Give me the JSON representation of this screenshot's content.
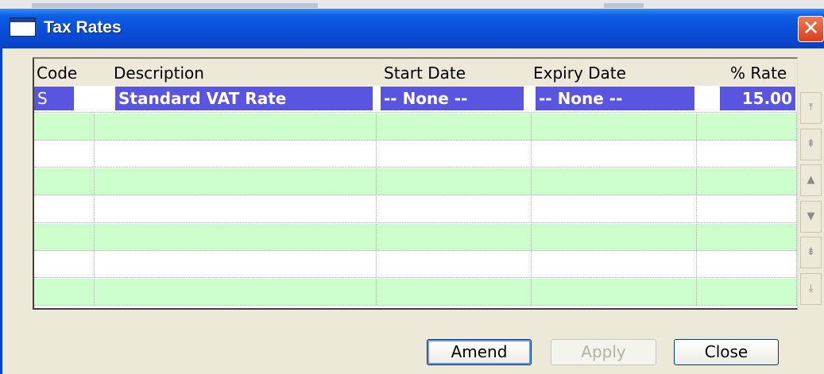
{
  "window": {
    "title": "Tax Rates",
    "close_glyph": "✕",
    "titlebar_color": "#0a50d8",
    "body_color": "#ece9d8"
  },
  "grid": {
    "columns": [
      "Code",
      "Description",
      "Start Date",
      "Expiry Date",
      "% Rate"
    ],
    "rows": [
      {
        "code": "S",
        "description": "Standard VAT Rate",
        "start_date": "-- None --",
        "expiry_date": "-- None --",
        "rate": "15.00",
        "selected": true
      },
      {
        "code": "",
        "description": "",
        "start_date": "",
        "expiry_date": "",
        "rate": ""
      },
      {
        "code": "",
        "description": "",
        "start_date": "",
        "expiry_date": "",
        "rate": ""
      },
      {
        "code": "",
        "description": "",
        "start_date": "",
        "expiry_date": "",
        "rate": ""
      },
      {
        "code": "",
        "description": "",
        "start_date": "",
        "expiry_date": "",
        "rate": ""
      },
      {
        "code": "",
        "description": "",
        "start_date": "",
        "expiry_date": "",
        "rate": ""
      },
      {
        "code": "",
        "description": "",
        "start_date": "",
        "expiry_date": "",
        "rate": ""
      },
      {
        "code": "",
        "description": "",
        "start_date": "",
        "expiry_date": "",
        "rate": ""
      }
    ],
    "row_colors": {
      "even": "#ccffcc",
      "odd": "#ffffff",
      "selected": "#5a55e0"
    }
  },
  "scroll_buttons": [
    {
      "name": "scroll-top-icon",
      "glyph": "⤒"
    },
    {
      "name": "scroll-page-up-icon",
      "glyph": "⇞"
    },
    {
      "name": "scroll-up-icon",
      "glyph": "▲"
    },
    {
      "name": "scroll-down-icon",
      "glyph": "▼"
    },
    {
      "name": "scroll-page-down-icon",
      "glyph": "⇟"
    },
    {
      "name": "scroll-bottom-icon",
      "glyph": "⤓"
    }
  ],
  "buttons": {
    "amend": "Amend",
    "apply": "Apply",
    "close": "Close"
  }
}
